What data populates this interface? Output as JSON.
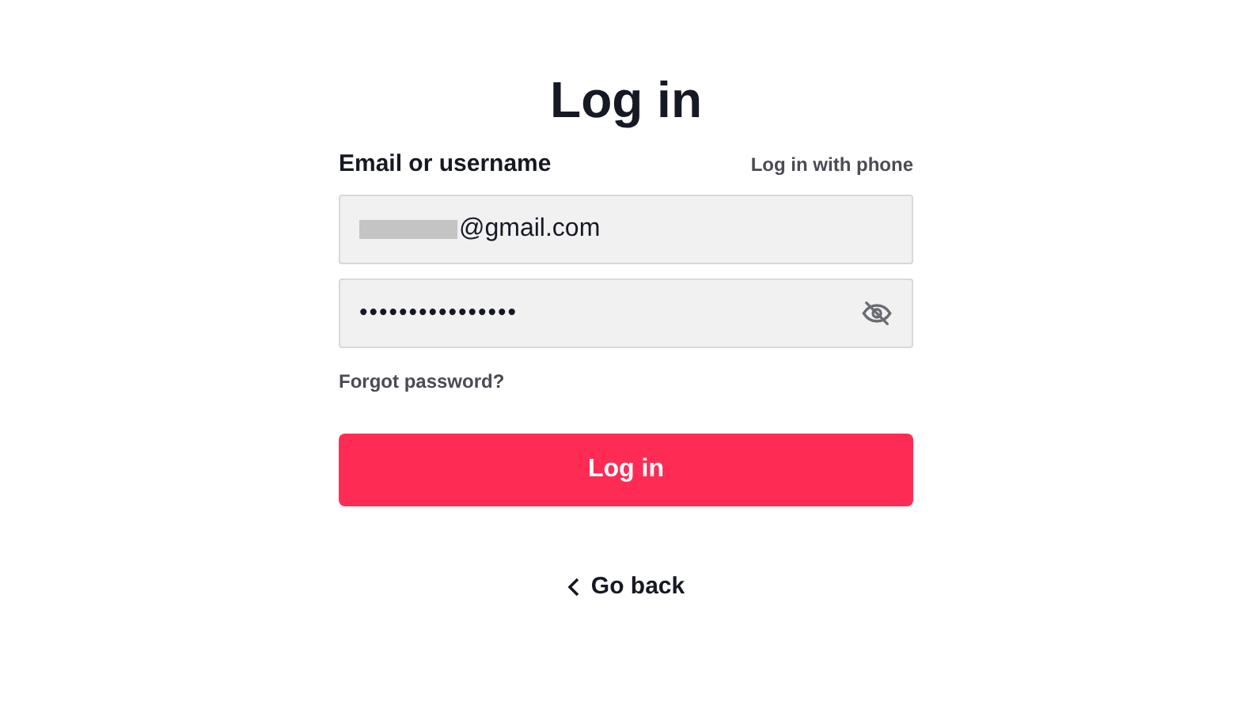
{
  "title": "Log in",
  "email_label": "Email or username",
  "phone_link": "Log in with phone",
  "email_field": {
    "value": "@gmail.com",
    "redacted": true
  },
  "password_field": {
    "value": "••••••••••••••••",
    "visible": false
  },
  "forgot_link": "Forgot password?",
  "login_button": "Log in",
  "back_link": "Go back"
}
